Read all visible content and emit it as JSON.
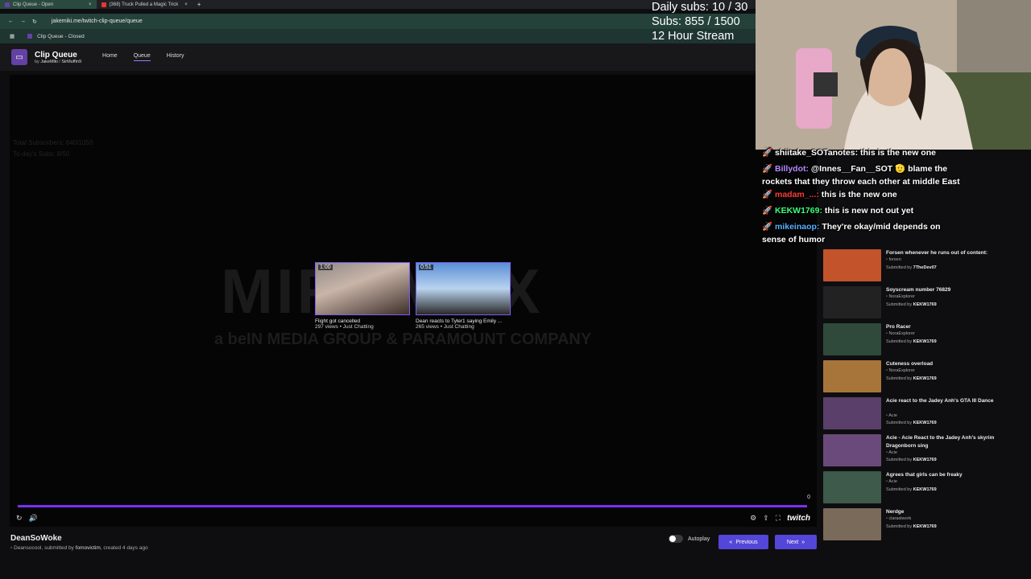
{
  "browser": {
    "tabs": [
      {
        "label": "Clip Queue - Open",
        "active": true
      },
      {
        "label": "(368) Truck Pulled a Magic Trick",
        "active": false
      }
    ],
    "url": "jakemiki.me/twitch-clip-queue/queue",
    "bookmark": "Clip Queue - Closed"
  },
  "app": {
    "title": "Clip Queue",
    "by_prefix": "by",
    "author1": "JakeMiki",
    "author_sep": "/",
    "author2": "SirMuffin9",
    "nav": [
      "Home",
      "Queue",
      "History"
    ]
  },
  "player": {
    "watermark_main": "MIRAMAX",
    "watermark_sub": "a beIN MEDIA GROUP & PARAMOUNT COMPANY",
    "faded_left": [
      "Total Subscribers: 840/1050",
      "To-day's Subs: 8/50"
    ],
    "cards": [
      {
        "duration": "1:00",
        "title": "Flight got cancelled",
        "meta": "297 views • Just Chatting"
      },
      {
        "duration": "0:51",
        "title": "Dean reacts to Tyler1 saying Emily ...",
        "meta": "265 views • Just Chatting"
      }
    ],
    "counter": "0",
    "brand": "twitch"
  },
  "current_clip": {
    "title": "DeanSoWoke",
    "creator": "Deansocool",
    "submitted_prefix": ", submitted by",
    "submitter": "fomovictim",
    "created": ", created 4 days ago"
  },
  "footer": {
    "autoplay_label": "Autoplay",
    "prev_label": "Previous",
    "next_label": "Next"
  },
  "overlay": {
    "line1": "Daily subs: 10 / 30",
    "line2": "Subs: 855 / 1500",
    "line3": "12 Hour Stream"
  },
  "chat": [
    {
      "user": "shiitake_SOTanotes:",
      "color": "#ffffff",
      "text": "this is the new one"
    },
    {
      "user": "Billydot:",
      "color": "#b58cff",
      "text": "@Innes__Fan__SOT 🫡 blame the",
      "cont": "rockets that they throw each other at middle East"
    },
    {
      "user": "madam_...:",
      "color": "#ff3b3b",
      "text": "this is the new one"
    },
    {
      "user": "KEKW1769:",
      "color": "#3bff7a",
      "text": "this is new not out yet"
    },
    {
      "user": "mikeinaop:",
      "color": "#5ab0ff",
      "text": "They're okay/mid depends on",
      "cont": "sense of humor"
    }
  ],
  "queue": [
    {
      "title": "Forsen whenever he runs out of content:",
      "creator": "forsen",
      "submitter": "7TheDev07",
      "color": "#c2532a"
    },
    {
      "title": "Soyscream number 76829",
      "creator": "NoraExplorer",
      "submitter": "KEKW1769",
      "color": "#222"
    },
    {
      "title": "Pro Racer",
      "creator": "NoraExplorer",
      "submitter": "KEKW1769",
      "color": "#2f4a3a"
    },
    {
      "title": "Cuteness overload",
      "creator": "NoraExplorer",
      "submitter": "KEKW1769",
      "color": "#a7753a"
    },
    {
      "title": "Acie react to the Jadey Anh's GTA III Dance",
      "creator": "Acie",
      "submitter": "KEKW1769",
      "color": "#5a3f6a"
    },
    {
      "title": "Acie - Acie React to the Jadey Anh's skyrim Dragonborn sing",
      "creator": "Acie",
      "submitter": "KEKW1769",
      "color": "#6a4a7a"
    },
    {
      "title": "Agrees that girls can be freaky",
      "creator": "Acie",
      "submitter": "KEKW1769",
      "color": "#3d5a4a"
    },
    {
      "title": "Nerdge",
      "creator": "clarastwork",
      "submitter": "KEKW1769",
      "color": "#7a6a5a"
    }
  ],
  "queue_submitted_prefix": "Submitted by"
}
